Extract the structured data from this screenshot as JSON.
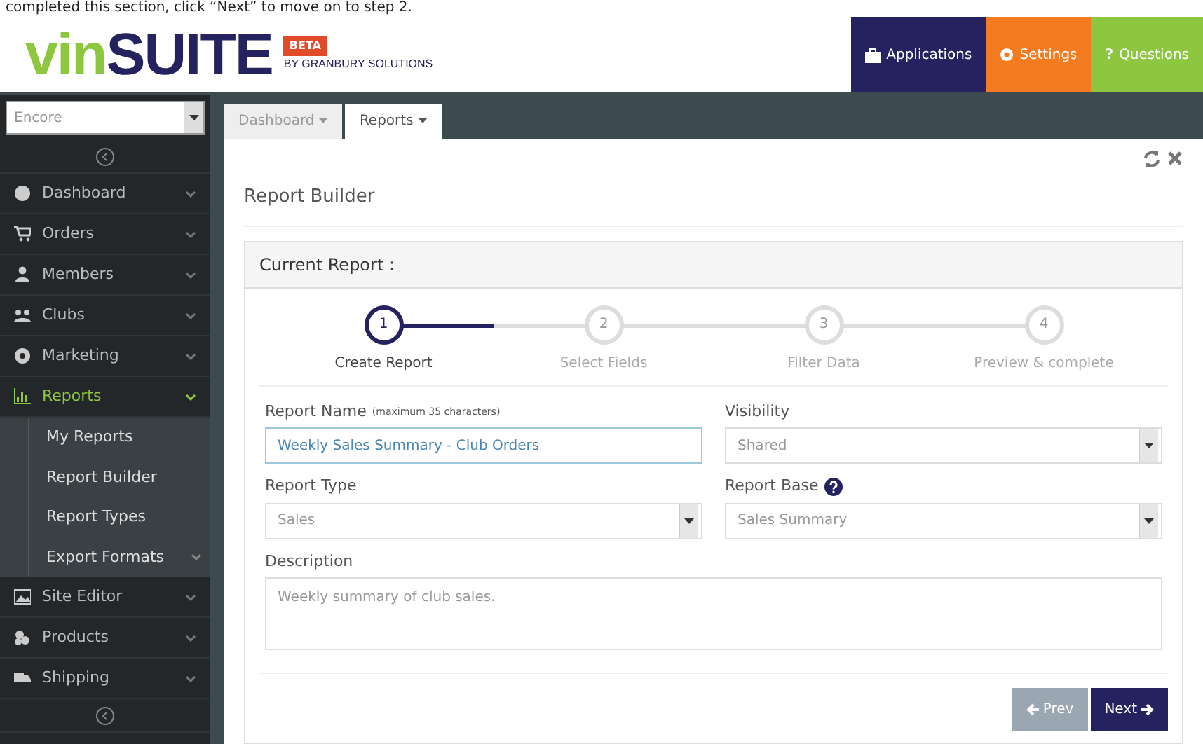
{
  "caption": "completed this section, click “Next” to move on to step 2.",
  "header": {
    "logo": {
      "part1": "vin",
      "part2": "SUITE"
    },
    "badge": "BETA",
    "byline": "BY GRANBURY SOLUTIONS",
    "nav": [
      {
        "label": "Applications",
        "kind": "apps"
      },
      {
        "label": "Settings",
        "kind": "settings"
      },
      {
        "label": "Questions",
        "kind": "help",
        "glyph": "?"
      }
    ]
  },
  "sidebar": {
    "site_select": "Encore",
    "items": [
      {
        "label": "Dashboard",
        "expanded": false
      },
      {
        "label": "Orders",
        "expanded": false
      },
      {
        "label": "Members",
        "expanded": false
      },
      {
        "label": "Clubs",
        "expanded": false
      },
      {
        "label": "Marketing",
        "expanded": false
      },
      {
        "label": "Reports",
        "expanded": true,
        "children": [
          {
            "label": "My Reports",
            "has_children": false
          },
          {
            "label": "Report Builder",
            "has_children": false
          },
          {
            "label": "Report Types",
            "has_children": false
          },
          {
            "label": "Export Formats",
            "has_children": true
          }
        ]
      },
      {
        "label": "Site Editor",
        "expanded": false
      },
      {
        "label": "Products",
        "expanded": false
      },
      {
        "label": "Shipping",
        "expanded": false
      }
    ]
  },
  "tabs": [
    {
      "label": "Dashboard",
      "selected": false
    },
    {
      "label": "Reports",
      "selected": true
    }
  ],
  "panel": {
    "title": "Report Builder",
    "section_title": "Current Report :",
    "steps": [
      {
        "number": "1",
        "label": "Create Report",
        "selected": true
      },
      {
        "number": "2",
        "label": "Select Fields",
        "selected": false
      },
      {
        "number": "3",
        "label": "Filter Data",
        "selected": false
      },
      {
        "number": "4",
        "label": "Preview & complete",
        "selected": false
      }
    ],
    "fields": [
      {
        "kind": "input",
        "label": "Report Name",
        "hint": "(maximum 35 characters)",
        "value": "Weekly Sales Summary - Club Orders",
        "focused": true
      },
      {
        "kind": "select",
        "label": "Visibility",
        "value": "Shared"
      },
      {
        "kind": "select",
        "label": "Report Type",
        "value": "Sales"
      },
      {
        "kind": "select",
        "label": "Report Base",
        "value": "Sales Summary",
        "help": true
      },
      {
        "kind": "textarea",
        "label": "Description",
        "value": "Weekly summary of club sales."
      }
    ],
    "buttons": [
      {
        "label": "Prev",
        "kind": "prev",
        "disabled": true
      },
      {
        "label": "Next",
        "kind": "next",
        "disabled": false
      }
    ]
  }
}
